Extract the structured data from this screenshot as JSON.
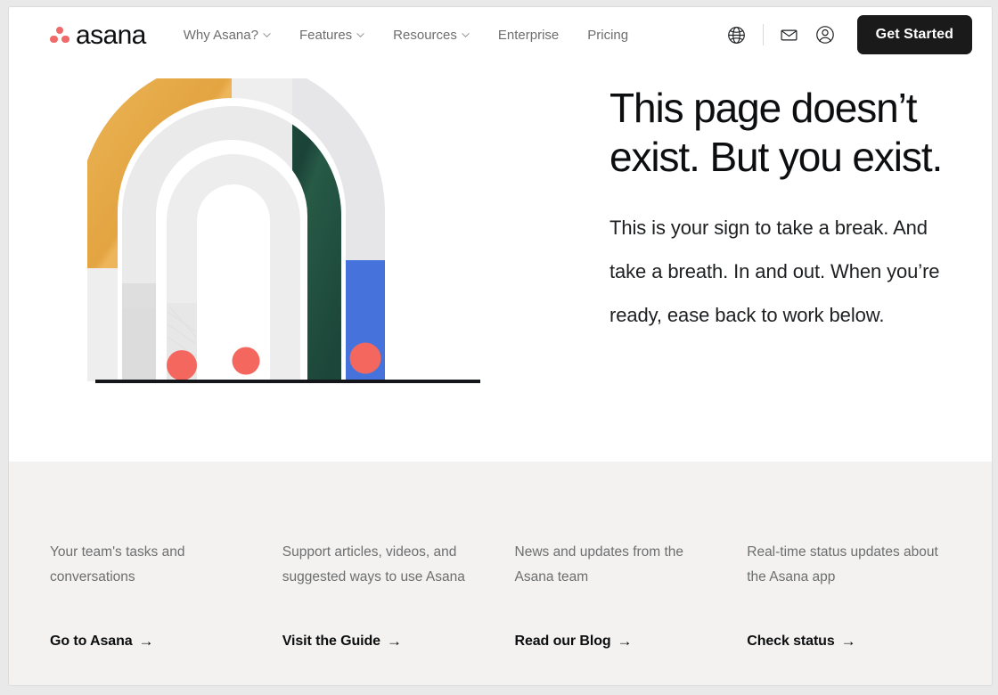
{
  "brand": {
    "name": "asana",
    "logo_icon": "asana-dots-logo",
    "dot_color": "#f06a6a"
  },
  "nav": {
    "items": [
      {
        "label": "Why Asana?",
        "has_dropdown": true,
        "icon": "chevron-down-icon"
      },
      {
        "label": "Features",
        "has_dropdown": true,
        "icon": "chevron-down-icon"
      },
      {
        "label": "Resources",
        "has_dropdown": true,
        "icon": "chevron-down-icon"
      },
      {
        "label": "Enterprise",
        "has_dropdown": false,
        "icon": ""
      },
      {
        "label": "Pricing",
        "has_dropdown": false,
        "icon": ""
      }
    ],
    "icons": [
      {
        "name": "globe-icon",
        "title": "Language"
      },
      {
        "name": "envelope-icon",
        "title": "Contact sales"
      },
      {
        "name": "account-icon",
        "title": "Log in"
      }
    ],
    "cta": {
      "label": "Get Started",
      "bg": "#1a1a1a",
      "fg": "#ffffff"
    }
  },
  "hero": {
    "headline": "This page doesn’t exist. But you exist.",
    "subcopy": "This is your sign to take a break. And take a breath. In and out. When you’re ready, ease back to work below.",
    "illustration": {
      "name": "nested-arches-illustration",
      "colors": {
        "yellow": "#e8aa4c",
        "light_gray": "#e4e4e6",
        "mid_gray": "#dddddd",
        "pale_gray": "#eeeeef",
        "green": "#1e4a3d",
        "blue": "#4573db",
        "coral": "#f4675f",
        "baseline": "#15161a"
      },
      "arch_count": 4,
      "dot_count": 3
    }
  },
  "footer": {
    "columns": [
      {
        "description": "Your team's tasks and conversations",
        "link": "Go to Asana",
        "arrow": "→"
      },
      {
        "description": "Support articles, videos, and suggested ways to use Asana",
        "link": "Visit the Guide",
        "arrow": "→"
      },
      {
        "description": "News and updates from the Asana team",
        "link": "Read our Blog",
        "arrow": "→"
      },
      {
        "description": "Real-time status updates about the Asana app",
        "link": "Check status",
        "arrow": "→"
      }
    ],
    "bg": "#f3f2f1"
  }
}
